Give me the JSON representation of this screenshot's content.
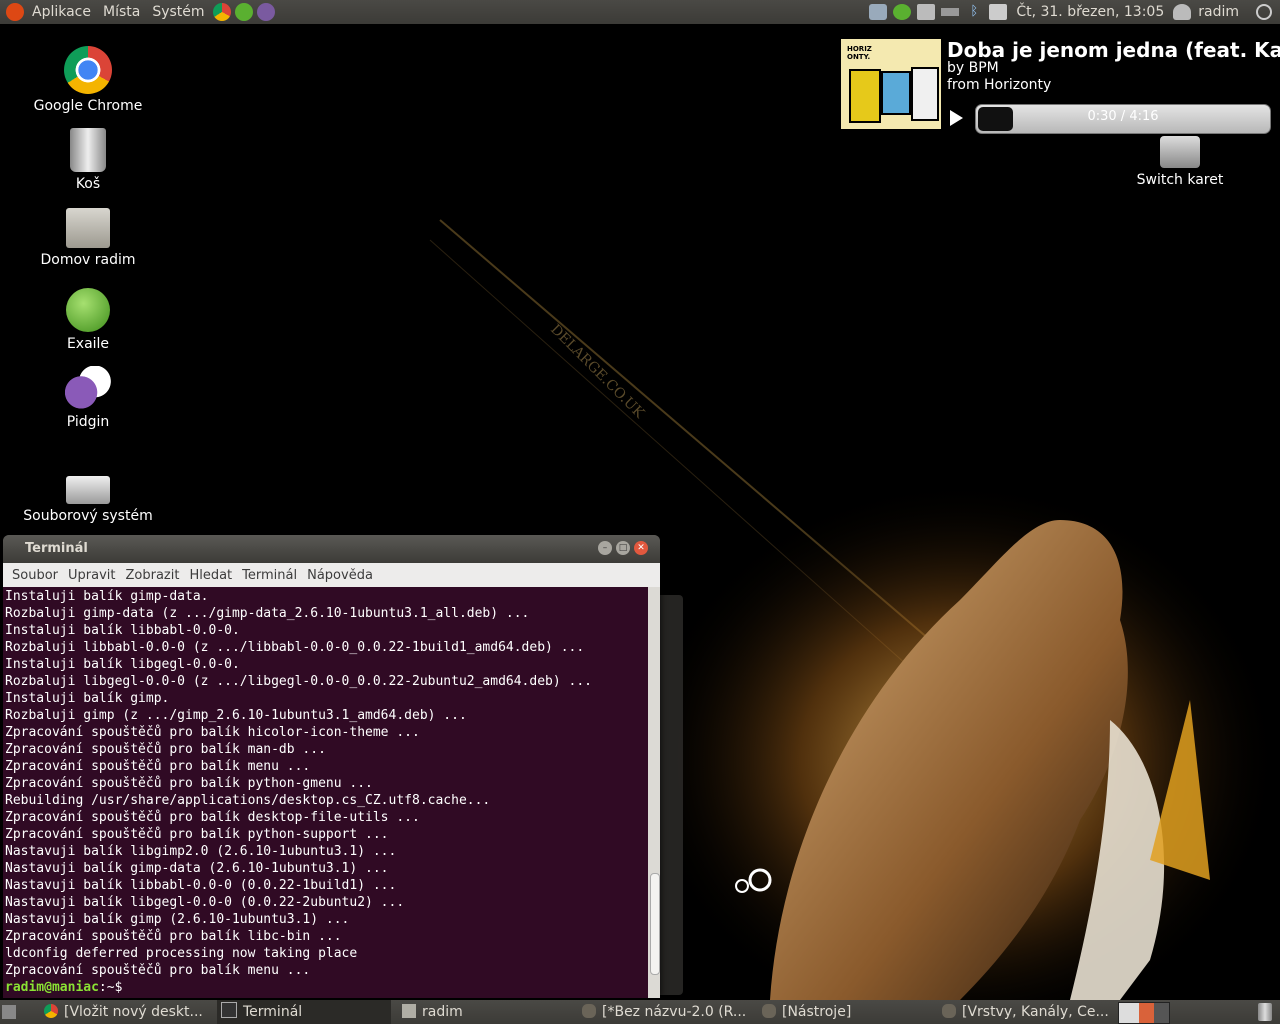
{
  "top_panel": {
    "menus": [
      "Aplikace",
      "Místa",
      "Systém"
    ],
    "clock": "Čt, 31. březen, 13:05",
    "user": "radim"
  },
  "desktop": {
    "icons": [
      {
        "label": "Google Chrome",
        "icon": "chrome-icon"
      },
      {
        "label": "Koš",
        "icon": "trash-icon"
      },
      {
        "label": "Domov radim",
        "icon": "home-folder-icon"
      },
      {
        "label": "Exaile",
        "icon": "exaile-icon"
      },
      {
        "label": "Pidgin",
        "icon": "pidgin-icon"
      },
      {
        "label": "Souborový systém",
        "icon": "drive-icon"
      },
      {
        "label": "Switch karet",
        "icon": "switch-karet-icon"
      }
    ],
    "wallpaper_text": "DELARGE.CO.UK"
  },
  "music": {
    "title": "Doba je jenom jedna (feat. Kato)",
    "artist": "by BPM",
    "album": "from Horizonty",
    "time": "0:30 / 4:16",
    "progress": 0.12,
    "album_art_text": "HORIZ ONTY."
  },
  "terminal": {
    "title": "Terminál",
    "menu": [
      "Soubor",
      "Upravit",
      "Zobrazit",
      "Hledat",
      "Terminál",
      "Nápověda"
    ],
    "lines": [
      "Instaluji balík gimp-data.",
      "Rozbaluji gimp-data (z .../gimp-data_2.6.10-1ubuntu3.1_all.deb) ...",
      "Instaluji balík libbabl-0.0-0.",
      "Rozbaluji libbabl-0.0-0 (z .../libbabl-0.0-0_0.0.22-1build1_amd64.deb) ...",
      "Instaluji balík libgegl-0.0-0.",
      "Rozbaluji libgegl-0.0-0 (z .../libgegl-0.0-0_0.0.22-2ubuntu2_amd64.deb) ...",
      "Instaluji balík gimp.",
      "Rozbaluji gimp (z .../gimp_2.6.10-1ubuntu3.1_amd64.deb) ...",
      "Zpracování spouštěčů pro balík hicolor-icon-theme ...",
      "Zpracování spouštěčů pro balík man-db ...",
      "Zpracování spouštěčů pro balík menu ...",
      "Zpracování spouštěčů pro balík python-gmenu ...",
      "Rebuilding /usr/share/applications/desktop.cs_CZ.utf8.cache...",
      "Zpracování spouštěčů pro balík desktop-file-utils ...",
      "Zpracování spouštěčů pro balík python-support ...",
      "Nastavuji balík libgimp2.0 (2.6.10-1ubuntu3.1) ...",
      "Nastavuji balík gimp-data (2.6.10-1ubuntu3.1) ...",
      "Nastavuji balík libbabl-0.0-0 (0.0.22-1build1) ...",
      "Nastavuji balík libgegl-0.0-0 (0.0.22-2ubuntu2) ...",
      "Nastavuji balík gimp (2.6.10-1ubuntu3.1) ...",
      "Zpracování spouštěčů pro balík libc-bin ...",
      "ldconfig deferred processing now taking place",
      "Zpracování spouštěčů pro balík menu ..."
    ],
    "prompt_user": "radim@maniac",
    "prompt_rest": ":~$"
  },
  "taskbar": {
    "items": [
      {
        "label": "[Vložit nový deskt...",
        "icon": "chrome-icon",
        "active": false
      },
      {
        "label": "Terminál",
        "icon": "terminal-icon",
        "active": true
      },
      {
        "label": "radim",
        "icon": "folder-icon",
        "active": false
      },
      {
        "label": "[*Bez názvu-2.0 (R...",
        "icon": "gimp-icon",
        "active": false
      },
      {
        "label": "[Nástroje]",
        "icon": "gimp-icon",
        "active": false
      },
      {
        "label": "[Vrstvy, Kanály, Ce...",
        "icon": "gimp-icon",
        "active": false
      }
    ]
  }
}
